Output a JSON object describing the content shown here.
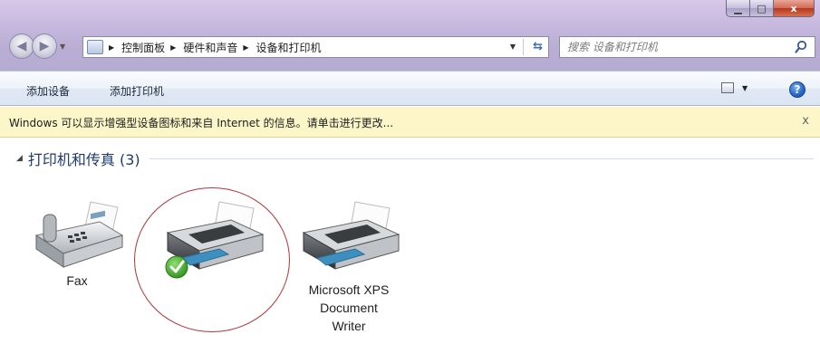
{
  "window": {
    "buttons": {
      "minimize": "▁",
      "maximize": "□",
      "close": "x"
    }
  },
  "address_bar": {
    "breadcrumbs": [
      "控制面板",
      "硬件和声音",
      "设备和打印机"
    ]
  },
  "search": {
    "placeholder": "搜索 设备和打印机"
  },
  "command_bar": {
    "add_device": "添加设备",
    "add_printer": "添加打印机",
    "help": "?"
  },
  "info_bar": {
    "message": "Windows 可以显示增强型设备图标和来自 Internet 的信息。请单击进行更改...",
    "close": "x"
  },
  "group": {
    "title": "打印机和传真 (3)"
  },
  "devices": [
    {
      "label": "Fax",
      "icon": "fax-icon"
    },
    {
      "label": "",
      "icon": "printer-icon",
      "default": true
    },
    {
      "label_lines": [
        "Microsoft XPS",
        "Document",
        "Writer"
      ],
      "icon": "printer-icon"
    }
  ],
  "colors": {
    "title_glass": "#c7b9de",
    "info_bar_bg": "#fdf6c8",
    "group_title": "#1e3a6e",
    "highlight_ring": "#b0353b",
    "default_check": "#3aa32a"
  }
}
